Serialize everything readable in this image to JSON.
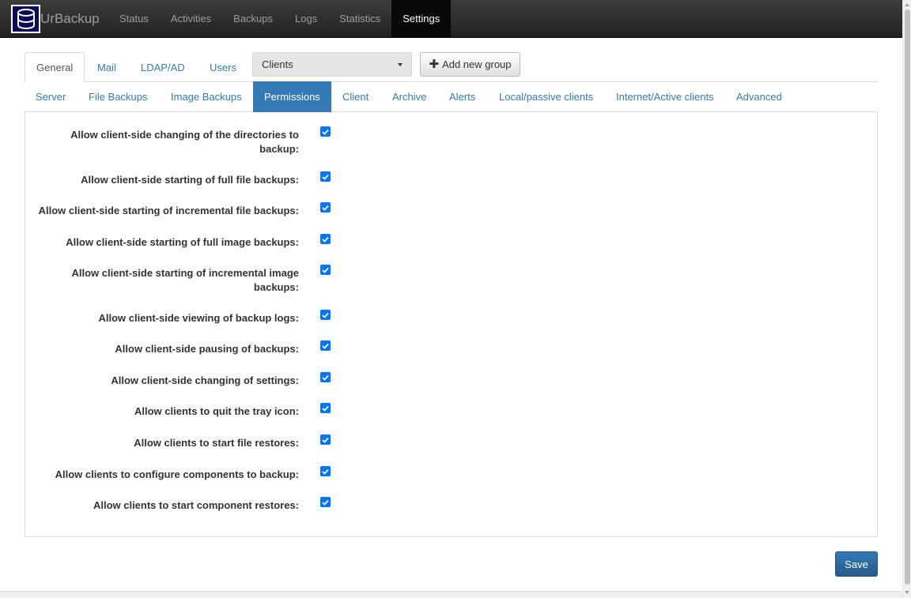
{
  "brand": {
    "name": "UrBackup"
  },
  "nav": [
    "Status",
    "Activities",
    "Backups",
    "Logs",
    "Statistics",
    "Settings"
  ],
  "nav_active": "Settings",
  "tabs_top": [
    "General",
    "Mail",
    "LDAP/AD",
    "Users"
  ],
  "tabs_top_active": "General",
  "group_select": {
    "value": "Clients"
  },
  "add_group_button": {
    "label": "Add new group"
  },
  "tabs_sub": [
    "Server",
    "File Backups",
    "Image Backups",
    "Permissions",
    "Client",
    "Archive",
    "Alerts",
    "Local/passive clients",
    "Internet/Active clients",
    "Advanced"
  ],
  "tabs_sub_active": "Permissions",
  "permissions": [
    {
      "label": "Allow client-side changing of the directories to backup:",
      "checked": true
    },
    {
      "label": "Allow client-side starting of full file backups:",
      "checked": true
    },
    {
      "label": "Allow client-side starting of incremental file backups:",
      "checked": true
    },
    {
      "label": "Allow client-side starting of full image backups:",
      "checked": true
    },
    {
      "label": "Allow client-side starting of incremental image backups:",
      "checked": true
    },
    {
      "label": "Allow client-side viewing of backup logs:",
      "checked": true
    },
    {
      "label": "Allow client-side pausing of backups:",
      "checked": true
    },
    {
      "label": "Allow client-side changing of settings:",
      "checked": true
    },
    {
      "label": "Allow clients to quit the tray icon:",
      "checked": true
    },
    {
      "label": "Allow clients to start file restores:",
      "checked": true
    },
    {
      "label": "Allow clients to configure components to backup:",
      "checked": true
    },
    {
      "label": "Allow clients to start component restores:",
      "checked": true
    }
  ],
  "save_button": {
    "label": "Save"
  },
  "colors": {
    "accent": "#337ab7",
    "navbar": "#222222",
    "checkbox": "#0075ff"
  }
}
